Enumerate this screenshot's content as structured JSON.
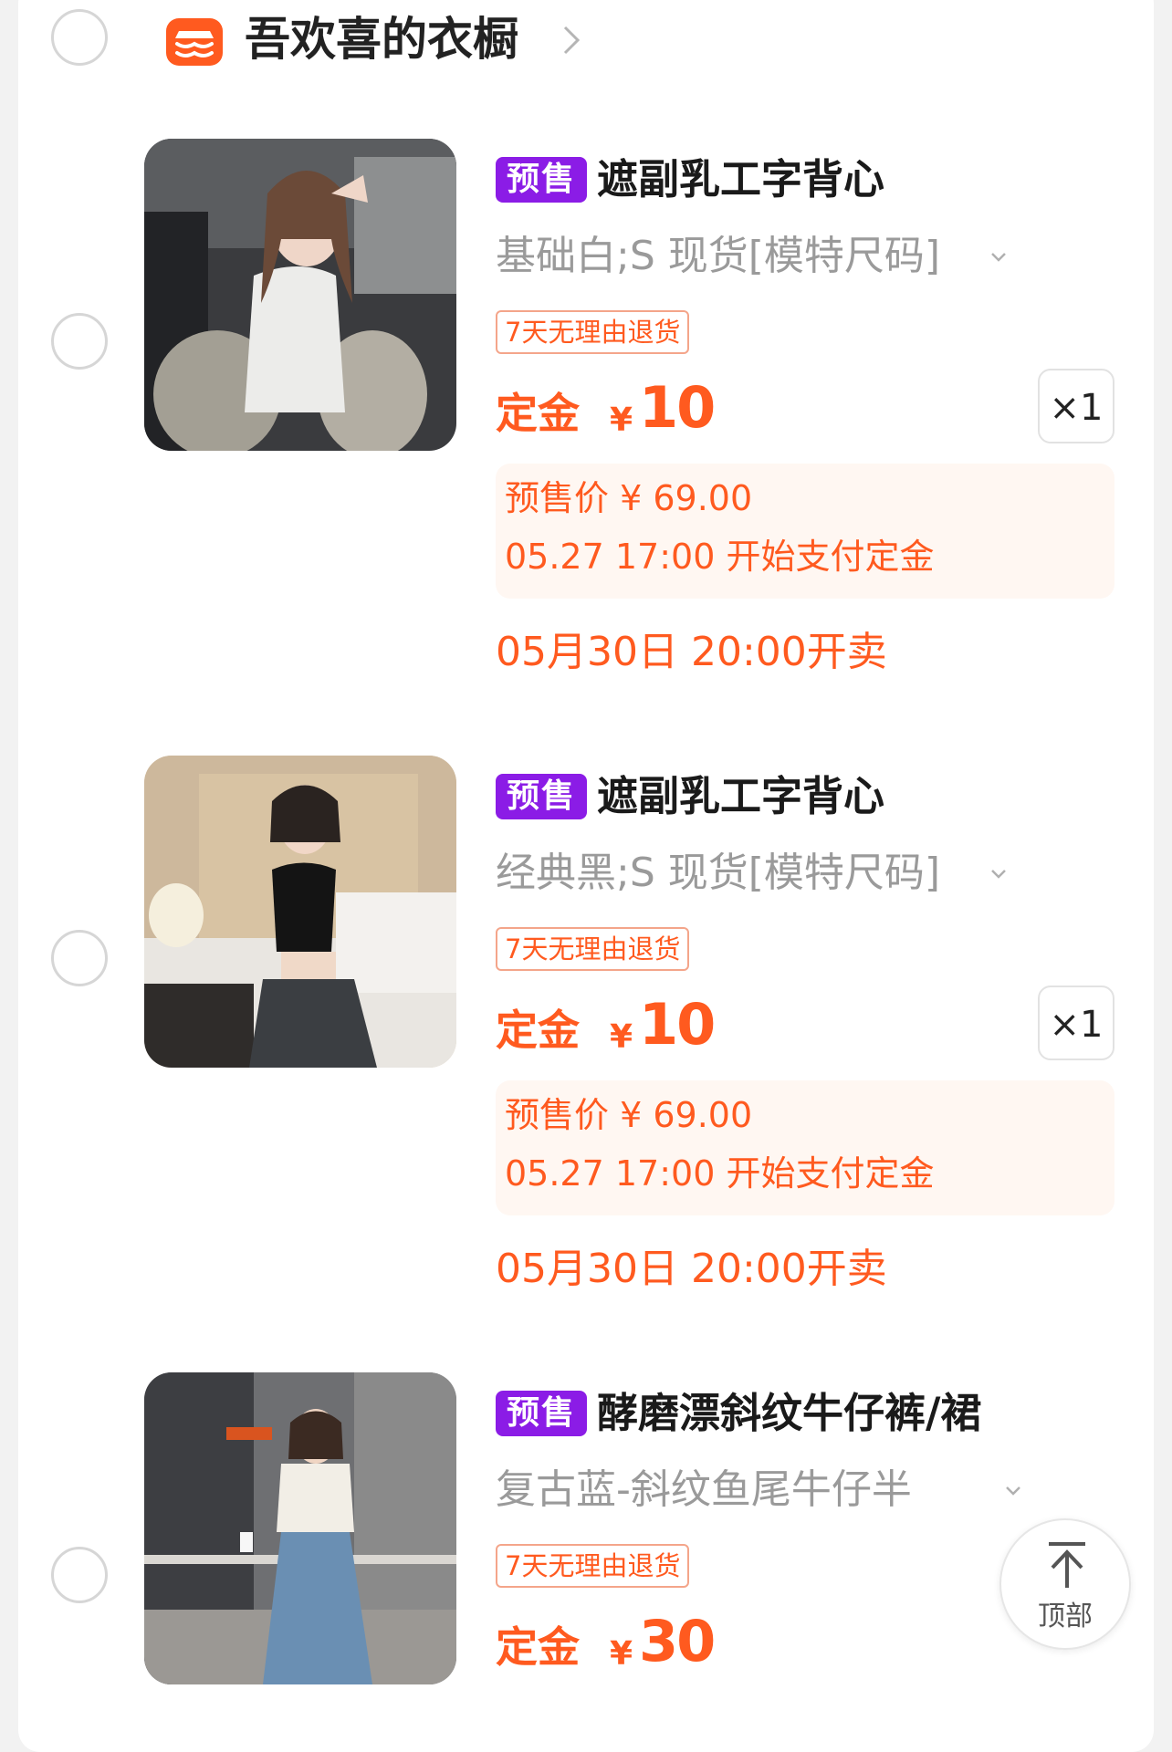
{
  "store": {
    "name": "吾欢喜的衣橱",
    "icon": "store-icon",
    "accent": "#ff5a1f"
  },
  "items": [
    {
      "tag": "预售",
      "title": "遮副乳工字背心",
      "sku": "基础白;S 现货[模特尺码]",
      "return_policy": "7天无理由退货",
      "deposit_label": "定金",
      "currency": "¥",
      "deposit_amount": "10",
      "quantity": "×1",
      "presale_price": "预售价 ¥ 69.00",
      "deposit_start": "05.27 17:00 开始支付定金",
      "sale_start": "05月30日 20:00开卖",
      "image": "white-tank-top-photo"
    },
    {
      "tag": "预售",
      "title": "遮副乳工字背心",
      "sku": "经典黑;S 现货[模特尺码]",
      "return_policy": "7天无理由退货",
      "deposit_label": "定金",
      "currency": "¥",
      "deposit_amount": "10",
      "quantity": "×1",
      "presale_price": "预售价 ¥ 69.00",
      "deposit_start": "05.27 17:00 开始支付定金",
      "sale_start": "05月30日 20:00开卖",
      "image": "black-tank-top-photo"
    },
    {
      "tag": "预售",
      "title": "酵磨漂斜纹牛仔裤/裙",
      "sku": "复古蓝-斜纹鱼尾牛仔半",
      "return_policy": "7天无理由退货",
      "deposit_label": "定金",
      "currency": "¥",
      "deposit_amount": "30",
      "image": "denim-skirt-photo"
    }
  ],
  "back_to_top": {
    "label": "顶部",
    "icon": "arrow-up-icon"
  },
  "colors": {
    "accent": "#ff5a1f",
    "presale_tag": "#8b1ce6",
    "presale_bg": "#fff7f2"
  }
}
